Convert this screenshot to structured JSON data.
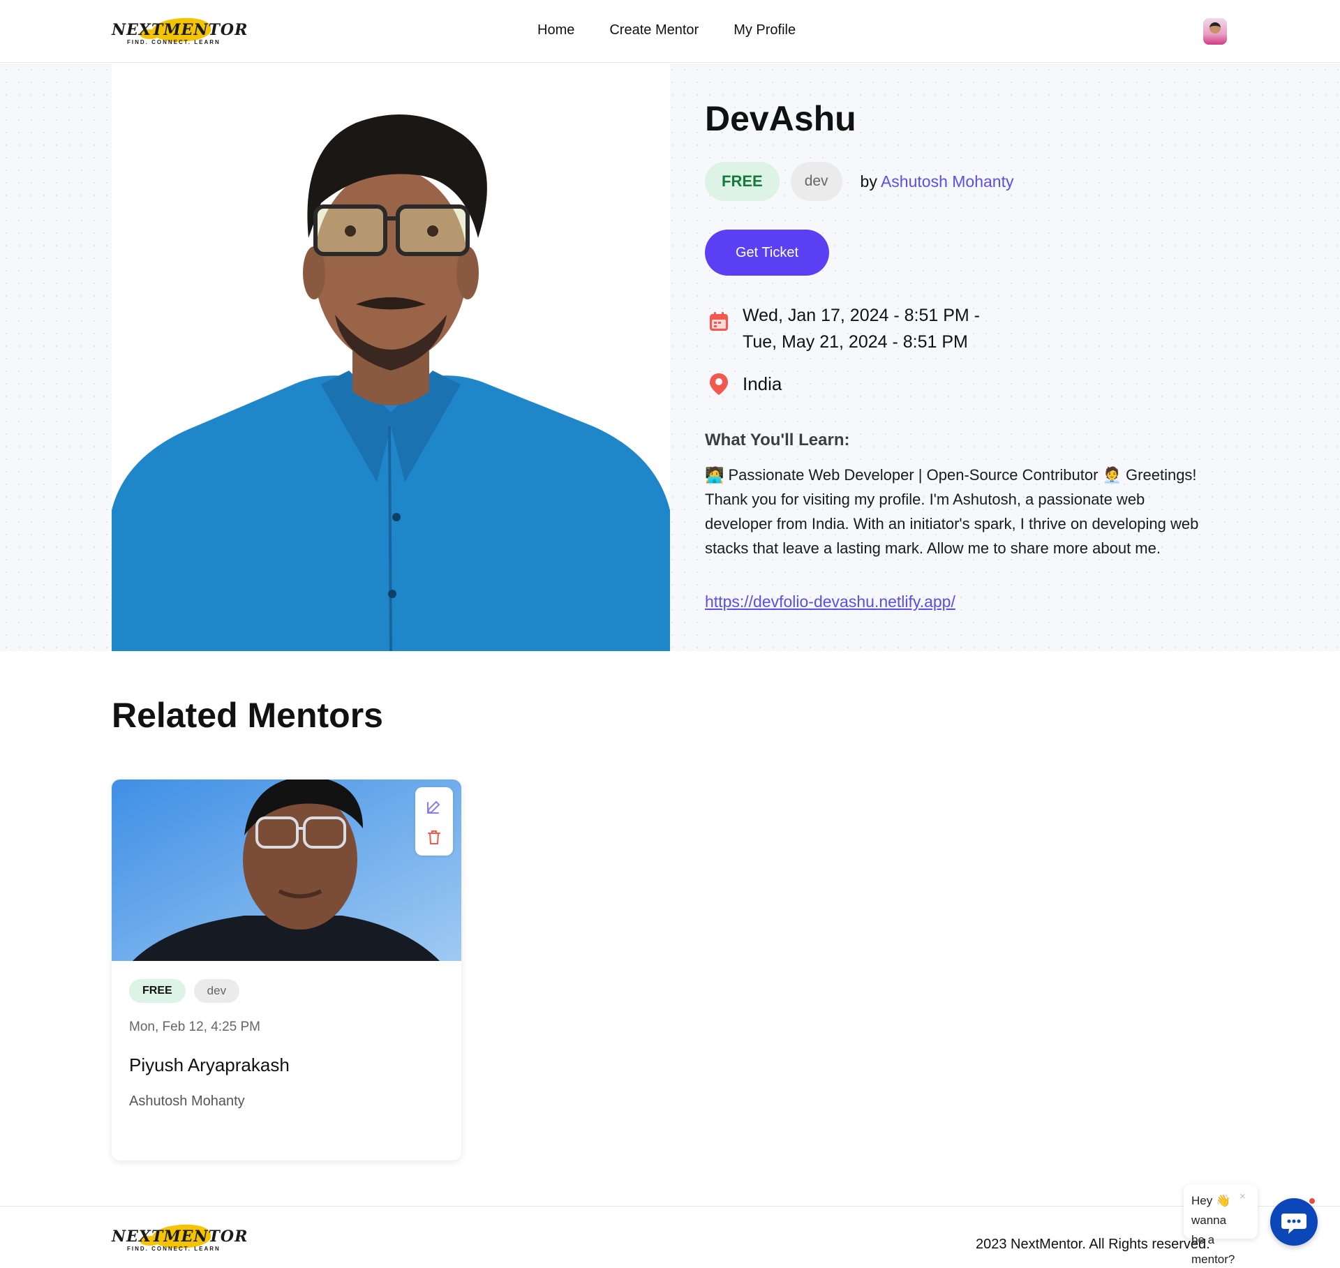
{
  "header": {
    "logo_text": "NEXTMENTOR",
    "logo_tagline": "FIND. CONNECT. LEARN",
    "nav": [
      "Home",
      "Create Mentor",
      "My Profile"
    ]
  },
  "event": {
    "title": "DevAshu",
    "price_badge": "FREE",
    "category_badge": "dev",
    "by_prefix": "by",
    "author": "Ashutosh Mohanty",
    "cta_label": "Get Ticket",
    "date_line1": "Wed, Jan 17, 2024 - 8:51 PM -",
    "date_line2": "Tue, May 21, 2024 - 8:51 PM",
    "location": "India",
    "learn_heading": "What You'll Learn:",
    "description": "🧑‍💻 Passionate Web Developer | Open-Source Contributor 🧑‍💼 Greetings! Thank you for visiting my profile. I'm Ashutosh, a passionate web developer from India. With an initiator's spark, I thrive on developing web stacks that leave a lasting mark. Allow me to share more about me.",
    "link": "https://devfolio-devashu.netlify.app/"
  },
  "related": {
    "heading": "Related Mentors",
    "cards": [
      {
        "price_badge": "FREE",
        "category_badge": "dev",
        "date": "Mon, Feb 12, 4:25 PM",
        "name": "Piyush Aryaprakash",
        "organizer": "Ashutosh Mohanty"
      }
    ]
  },
  "footer": {
    "logo_text": "NEXTMENTOR",
    "logo_tagline": "FIND. CONNECT. LEARN",
    "copyright": "2023 NextMentor. All Rights reserved."
  },
  "chat": {
    "bubble_text": "Hey 👋 wanna be a mentor?",
    "close_symbol": "×"
  },
  "colors": {
    "accent": "#5b40f3",
    "link": "#5b4ee8",
    "free_badge_bg": "#dcf3e6",
    "free_badge_text": "#157a3c",
    "icon_red": "#f2584e",
    "chat_button": "#0b47b8"
  },
  "icons": {
    "calendar": "calendar-icon",
    "location": "location-pin-icon",
    "edit": "edit-icon",
    "delete": "trash-icon",
    "chat": "chat-icon"
  }
}
